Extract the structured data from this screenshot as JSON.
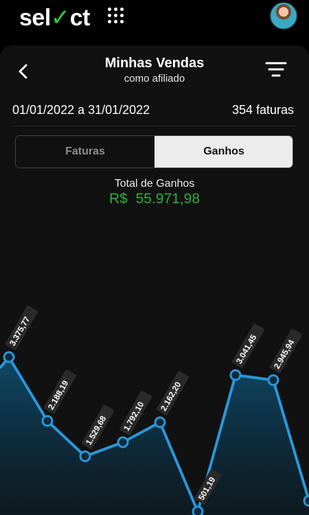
{
  "header": {
    "logo_text_a": "sel",
    "logo_text_b": "ct",
    "menu_icon": "grid-dots-icon",
    "avatar_icon": "user-avatar"
  },
  "page": {
    "title": "Minhas Vendas",
    "subtitle": "como afiliado",
    "back_icon": "chevron-left-icon",
    "filter_icon": "filter-lines-icon",
    "period": "01/01/2022 a 31/01/2022",
    "invoice_count": "354 faturas"
  },
  "tabs": [
    {
      "label": "Faturas",
      "active": false
    },
    {
      "label": "Ganhos",
      "active": true
    }
  ],
  "summary": {
    "total_label": "Total de Ganhos",
    "total_value": "R$  55.971,98"
  },
  "colors": {
    "accent_line": "#2a97d9",
    "area_fill_top": "#0f4d6e",
    "positive_value": "#2bb03b"
  },
  "chart_data": {
    "type": "area",
    "values": [
      3375.77,
      2188.19,
      1529.68,
      1792.1,
      2162.2,
      501.19,
      3041.45,
      2945.94,
      700
    ],
    "labels": [
      "3.375,77",
      "2.188,19",
      "1.529,68",
      "1.792,10",
      "2.162,20",
      "501,19",
      "3.041,45",
      "2.945,94",
      ""
    ]
  }
}
